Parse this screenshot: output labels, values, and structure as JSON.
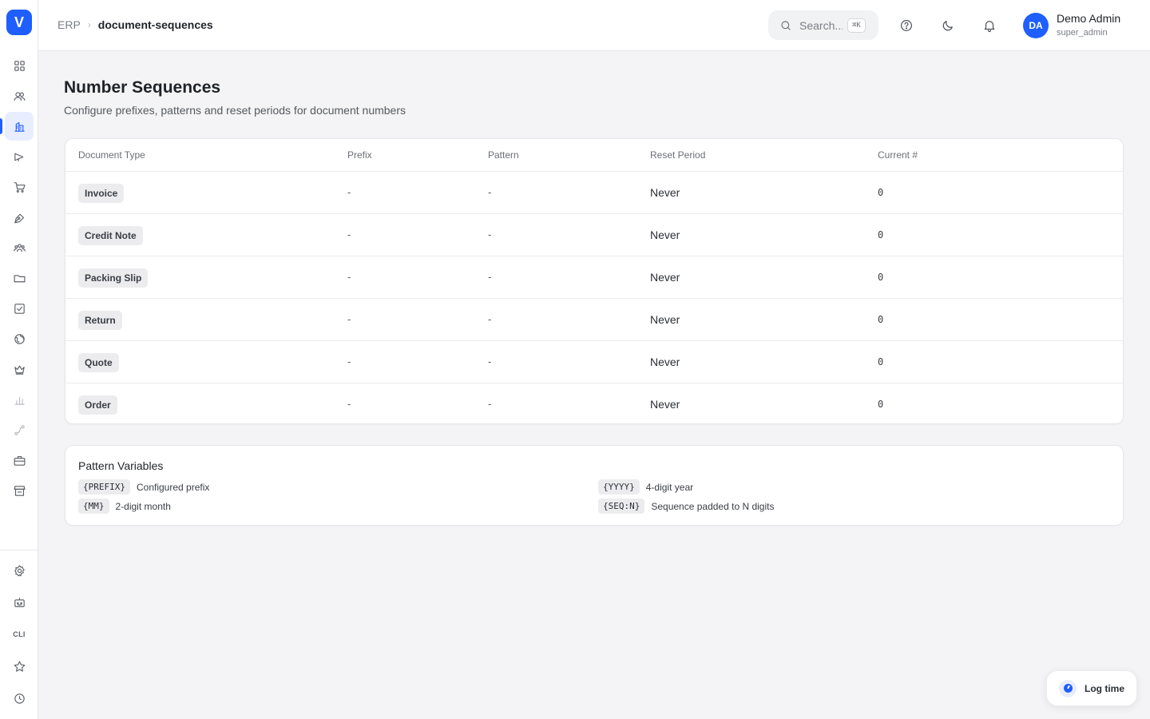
{
  "app": {
    "logo_letter": "V"
  },
  "breadcrumb": {
    "root": "ERP",
    "separator": "›",
    "current": "document-sequences"
  },
  "search": {
    "placeholder": "Search...",
    "shortcut": "⌘K"
  },
  "user": {
    "initials": "DA",
    "name": "Demo Admin",
    "role": "super_admin"
  },
  "sidebar": {
    "items": [
      {
        "icon": "grid-icon"
      },
      {
        "icon": "users-icon"
      },
      {
        "icon": "building-icon",
        "active": true
      },
      {
        "icon": "megaphone-icon"
      },
      {
        "icon": "cart-icon"
      },
      {
        "icon": "pen-tool-icon"
      },
      {
        "icon": "team-icon"
      },
      {
        "icon": "folder-icon"
      },
      {
        "icon": "checkbox-icon"
      },
      {
        "icon": "globe-icon"
      },
      {
        "icon": "crown-icon"
      },
      {
        "icon": "bar-chart-icon",
        "disabled": true
      },
      {
        "icon": "route-icon",
        "disabled": true
      },
      {
        "icon": "briefcase-icon"
      },
      {
        "icon": "store-icon"
      }
    ],
    "bottom_items": [
      {
        "icon": "settings-icon"
      },
      {
        "icon": "bot-icon"
      },
      {
        "label": "CLI"
      },
      {
        "icon": "star-icon"
      },
      {
        "icon": "clock-icon"
      }
    ]
  },
  "page": {
    "title": "Number Sequences",
    "subtitle": "Configure prefixes, patterns and reset periods for document numbers"
  },
  "table": {
    "columns": [
      "Document Type",
      "Prefix",
      "Pattern",
      "Reset Period",
      "Current #"
    ],
    "rows": [
      {
        "type": "Invoice",
        "prefix": "-",
        "pattern": "-",
        "reset": "Never",
        "current": "0"
      },
      {
        "type": "Credit Note",
        "prefix": "-",
        "pattern": "-",
        "reset": "Never",
        "current": "0"
      },
      {
        "type": "Packing Slip",
        "prefix": "-",
        "pattern": "-",
        "reset": "Never",
        "current": "0"
      },
      {
        "type": "Return",
        "prefix": "-",
        "pattern": "-",
        "reset": "Never",
        "current": "0"
      },
      {
        "type": "Quote",
        "prefix": "-",
        "pattern": "-",
        "reset": "Never",
        "current": "0"
      },
      {
        "type": "Order",
        "prefix": "-",
        "pattern": "-",
        "reset": "Never",
        "current": "0"
      }
    ]
  },
  "pattern_variables": {
    "title": "Pattern Variables",
    "items": [
      {
        "code": "{PREFIX}",
        "desc": "Configured prefix"
      },
      {
        "code": "{YYYY}",
        "desc": "4-digit year"
      },
      {
        "code": "{MM}",
        "desc": "2-digit month"
      },
      {
        "code": "{SEQ:N}",
        "desc": "Sequence padded to N digits"
      }
    ]
  },
  "log_time": {
    "label": "Log time"
  },
  "colors": {
    "accent": "#1f5eff",
    "background": "#f4f4f6",
    "badge": "#ececef"
  }
}
